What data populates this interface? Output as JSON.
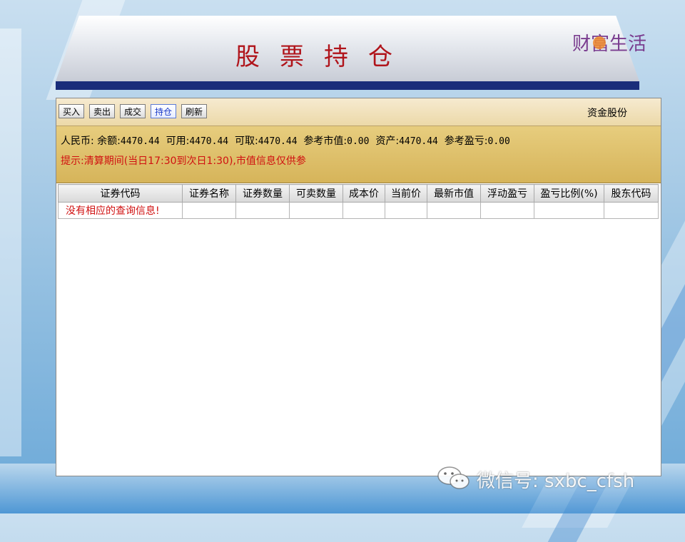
{
  "slide": {
    "title": "股票持仓",
    "logo_text": "财富生活"
  },
  "toolbar": {
    "buttons": [
      {
        "label": "买入"
      },
      {
        "label": "卖出"
      },
      {
        "label": "成交"
      },
      {
        "label": "持仓"
      },
      {
        "label": "刷新"
      }
    ],
    "active": "持仓",
    "account_name": "资金股份"
  },
  "summary": {
    "currency_label": "人民币:",
    "balance_label": "余额:",
    "balance": "4470.44",
    "available_label": "可用:",
    "available": "4470.44",
    "withdrawable_label": "可取:",
    "withdrawable": "4470.44",
    "market_value_label": "参考市值:",
    "market_value": "0.00",
    "assets_label": "资产:",
    "assets": "4470.44",
    "profit_label": "参考盈亏:",
    "profit": "0.00",
    "notice": "提示:清算期间(当日17:30到次日1:30),市值信息仅供参"
  },
  "table": {
    "columns": [
      "证券代码",
      "证券名称",
      "证券数量",
      "可卖数量",
      "成本价",
      "当前价",
      "最新市值",
      "浮动盈亏",
      "盈亏比例(%)",
      "股东代码"
    ],
    "empty_message": "没有相应的查询信息!"
  },
  "watermark": {
    "text": "微信号: sxbc_cfsh"
  },
  "colors": {
    "title_red": "#b0141b",
    "header_bar": "#1a2d7a",
    "panel_gold": "#d6b45a",
    "notice_red": "#d01010"
  }
}
